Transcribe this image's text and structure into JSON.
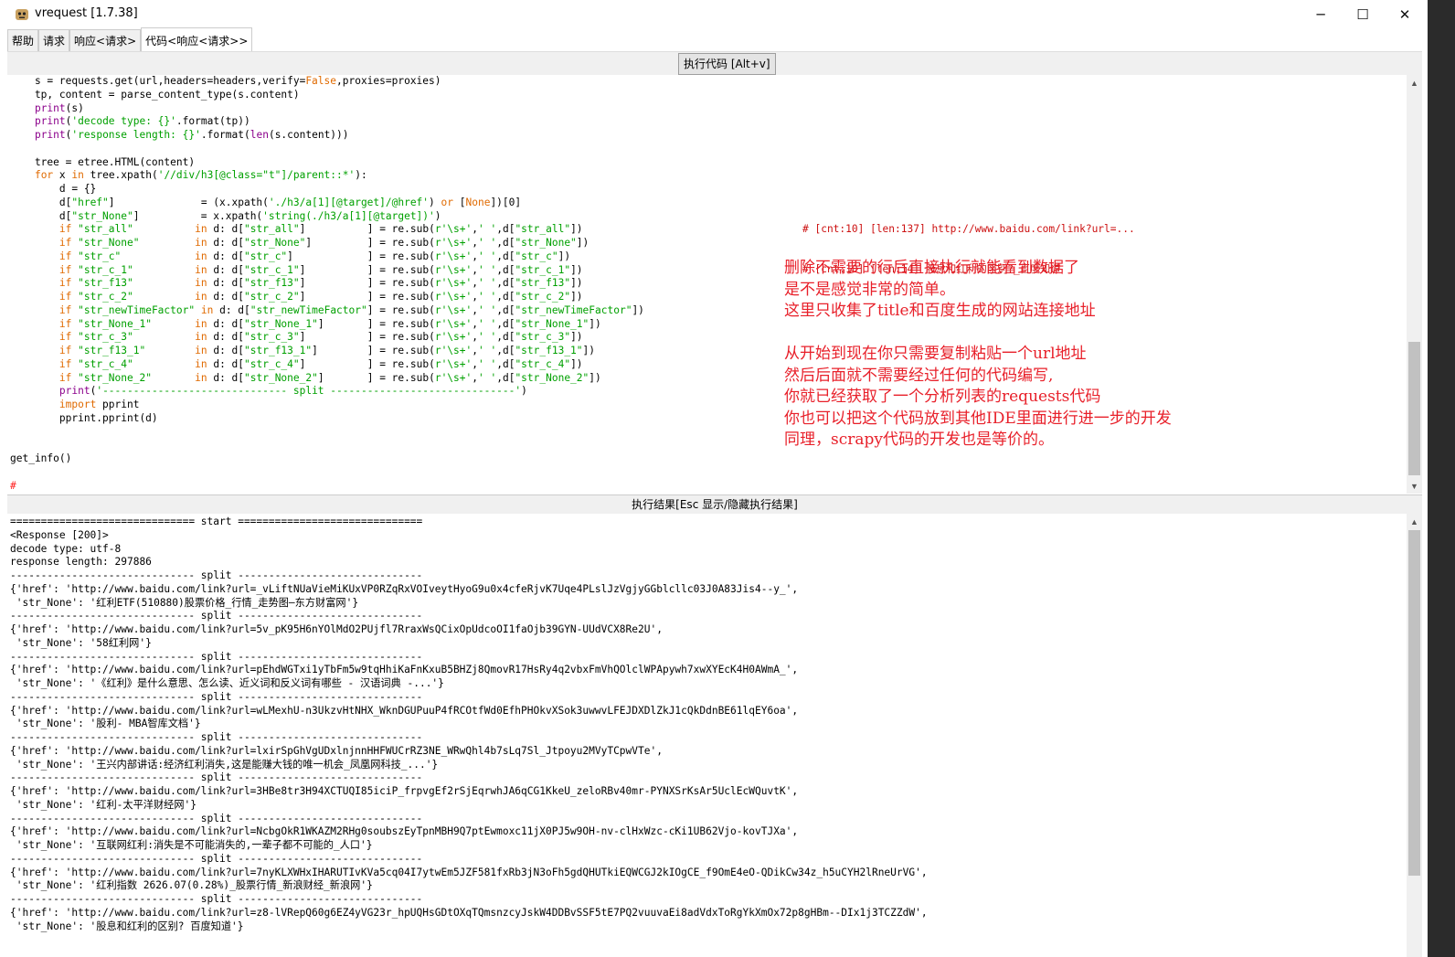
{
  "window": {
    "title": "vrequest [1.7.38]",
    "minimize_glyph": "─",
    "maximize_glyph": "☐",
    "close_glyph": "✕"
  },
  "tabs": [
    {
      "label": "帮助"
    },
    {
      "label": "请求"
    },
    {
      "label": "响应<请求>"
    },
    {
      "label": "代码<响应<请求>>",
      "active": true
    }
  ],
  "toolbar": {
    "run_label": "执行代码 [Alt+v]"
  },
  "editor": {
    "code_lines": [
      "    s = requests.get(url,headers=headers,verify=False,proxies=proxies)",
      "    tp, content = parse_content_type(s.content)",
      "    print(s)",
      "    print('decode type: {}'.format(tp))",
      "    print('response length: {}'.format(len(s.content)))",
      "",
      "    tree = etree.HTML(content)",
      "    for x in tree.xpath('//div/h3[@class=\"t\"]/parent::*'):",
      "        d = {}",
      "        d[\"href\"]              = (x.xpath('./h3/a[1][@target]/@href') or [None])[0]",
      "        d[\"str_None\"]          = x.xpath('string(./h3/a[1][@target])')",
      "        if \"str_all\"          in d: d[\"str_all\"]          ] = re.sub(r'\\s+',' ',d[\"str_all\"])",
      "        if \"str_None\"         in d: d[\"str_None\"]         ] = re.sub(r'\\s+',' ',d[\"str_None\"])",
      "        if \"str_c\"            in d: d[\"str_c\"]            ] = re.sub(r'\\s+',' ',d[\"str_c\"])",
      "        if \"str_c_1\"          in d: d[\"str_c_1\"]          ] = re.sub(r'\\s+',' ',d[\"str_c_1\"])",
      "        if \"str_f13\"          in d: d[\"str_f13\"]          ] = re.sub(r'\\s+',' ',d[\"str_f13\"])",
      "        if \"str_c_2\"          in d: d[\"str_c_2\"]          ] = re.sub(r'\\s+',' ',d[\"str_c_2\"])",
      "        if \"str_newTimeFactor\" in d: d[\"str_newTimeFactor\"] = re.sub(r'\\s+',' ',d[\"str_newTimeFactor\"])",
      "        if \"str_None_1\"       in d: d[\"str_None_1\"]       ] = re.sub(r'\\s+',' ',d[\"str_None_1\"])",
      "        if \"str_c_3\"          in d: d[\"str_c_3\"]          ] = re.sub(r'\\s+',' ',d[\"str_c_3\"])",
      "        if \"str_f13_1\"        in d: d[\"str_f13_1\"]        ] = re.sub(r'\\s+',' ',d[\"str_f13_1\"])",
      "        if \"str_c_4\"          in d: d[\"str_c_4\"]          ] = re.sub(r'\\s+',' ',d[\"str_c_4\"])",
      "        if \"str_None_2\"       in d: d[\"str_None_2\"]       ] = re.sub(r'\\s+',' ',d[\"str_None_2\"])",
      "        print('------------------------------ split ------------------------------')",
      "        import pprint",
      "        pprint.pprint(d)",
      "",
      "",
      "get_info()",
      "",
      "#"
    ],
    "inline_comments": [
      "# [cnt:10] [len:137] http://www.baidu.com/link?url=...",
      "# [cnt:10] [len:14] 股息和红利的区别?_百度知道"
    ]
  },
  "annotation_lines": [
    "删除不需要的行后直接执行就能看到数据了",
    "是不是感觉非常的简单。",
    "这里只收集了title和百度生成的网站连接地址",
    "",
    "从开始到现在你只需要复制粘贴一个url地址",
    "然后后面就不需要经过任何的代码编写,",
    "你就已经获取了一个分析列表的requests代码",
    "你也可以把这个代码放到其他IDE里面进行进一步的开发",
    "同理，scrapy代码的开发也是等价的。"
  ],
  "result_bar": {
    "label": "执行结果[Esc 显示/隐藏执行结果]"
  },
  "output_lines": [
    "============================== start ==============================",
    "<Response [200]>",
    "decode type: utf-8",
    "response length: 297886",
    "------------------------------ split ------------------------------",
    "{'href': 'http://www.baidu.com/link?url=_vLiftNUaVieMiKUxVP0RZqRxVOIveytHyoG9u0x4cfeRjvK7Uqe4PLslJzVgjyGGblcllc03J0A83Jis4--y_',",
    " 'str_None': '红利ETF(510880)股票价格_行情_走势图—东方财富网'}",
    "------------------------------ split ------------------------------",
    "{'href': 'http://www.baidu.com/link?url=5v_pK95H6nYOlMdO2PUjfl7RraxWsQCixOpUdcoOI1faOjb39GYN-UUdVCX8Re2U',",
    " 'str_None': '58红利网'}",
    "------------------------------ split ------------------------------",
    "{'href': 'http://www.baidu.com/link?url=pEhdWGTxi1yTbFm5w9tqHhiKaFnKxuB5BHZj8QmovR17HsRy4q2vbxFmVhQOlclWPApywh7xwXYEcK4H0AWmA_',",
    " 'str_None': '《红利》是什么意思、怎么读、近义词和反义词有哪些 - 汉语词典 -...'}",
    "------------------------------ split ------------------------------",
    "{'href': 'http://www.baidu.com/link?url=wLMexhU-n3UkzvHtNHX_WknDGUPuuP4fRCOtfWd0EfhPHOkvXSok3uwwvLFEJDXDlZkJ1cQkDdnBE61lqEY6oa',",
    " 'str_None': '股利- MBA智库文档'}",
    "------------------------------ split ------------------------------",
    "{'href': 'http://www.baidu.com/link?url=lxirSpGhVgUDxlnjnnHHFWUCrRZ3NE_WRwQhl4b7sLq7Sl_Jtpoyu2MVyTCpwVTe',",
    " 'str_None': '王兴内部讲话:经济红利消失,这是能赚大钱的唯一机会_凤凰网科技_...'}",
    "------------------------------ split ------------------------------",
    "{'href': 'http://www.baidu.com/link?url=3HBe8tr3H94XCTUQI85iciP_frpvgEf2rSjEqrwhJA6qCG1KkeU_zeloRBv40mr-PYNXSrKsAr5UclEcWQuvtK',",
    " 'str_None': '红利-太平洋财经网'}",
    "------------------------------ split ------------------------------",
    "{'href': 'http://www.baidu.com/link?url=NcbgOkR1WKAZM2RHg0soubszEyTpnMBH9Q7ptEwmoxc11jX0PJ5w9OH-nv-clHxWzc-cKi1UB62Vjo-kovTJXa',",
    " 'str_None': '互联网红利:消失是不可能消失的,一辈子都不可能的_人口'}",
    "------------------------------ split ------------------------------",
    "{'href': 'http://www.baidu.com/link?url=7nyKLXWHxIHARUTIvKVa5cq04I7ytwEm5JZF581fxRb3jN3oFh5gdQHUTkiEQWCGJ2kIOgCE_f9OmE4eO-QDikCw34z_h5uCYH2lRneUrVG',",
    " 'str_None': '红利指数 2626.07(0.28%)_股票行情_新浪财经_新浪网'}",
    "------------------------------ split ------------------------------",
    "{'href': 'http://www.baidu.com/link?url=z8-lVRepQ60g6EZ4yVG23r_hpUQHsGDtOXqTQmsnzcyJskW4DDBvSSF5tE7PQ2vuuvaEi8adVdxToRgYkXmOx72p8gHBm--DIx1j3TCZZdW',",
    " 'str_None': '股息和红利的区别? 百度知道'}"
  ],
  "colors": {
    "keyword": "#e06a00",
    "builtin": "#8b008b",
    "string": "#00a000",
    "comment": "#cc1010",
    "annotation": "#e8202a"
  }
}
